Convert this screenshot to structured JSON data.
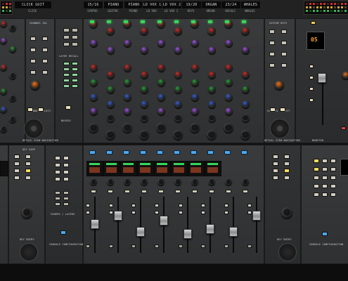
{
  "console": {
    "name": "Mixing Console Surface"
  },
  "scribble_strips": [
    {
      "top": "CLICK GUIT",
      "sub": "CLICK"
    },
    {
      "top": "15/16",
      "sub": "SYNTHS"
    },
    {
      "top": "PIANO",
      "sub": "GUITAR"
    },
    {
      "top": "PIANO",
      "sub": "PIANO"
    },
    {
      "top": "LD VOX 1",
      "sub": "LD VOX"
    },
    {
      "top": "LD VOX 2",
      "sub": "LD VOX 2"
    },
    {
      "top": "19/20",
      "sub": "KEYS"
    },
    {
      "top": "ORGAN",
      "sub": "ORGAN"
    },
    {
      "top": "23/24",
      "sub": "VOCALS"
    },
    {
      "top": "WHALES",
      "sub": "WHALES"
    }
  ],
  "captions": {
    "left_top": "CHANNEL SEL",
    "left_mid": "CHANNEL SELECT",
    "left_bottom": "DETAIL VIEW NAVIGATION",
    "comp_top": "COMP",
    "gate_top": "GATE",
    "layers": "ALL SOLO",
    "layer_recall": "LAYER RECALL",
    "busses": "BUSSES",
    "custom": "CUSTOM",
    "channel_strips": "CHANNEL STRIPS",
    "right_top": "CUSTOM KEYS",
    "right_mid": "CHANNEL SELECT",
    "right_bottom": "DETAIL VIEW NAVIGATION",
    "far_right": "MONITOR",
    "keys_left": "KEY SAFE",
    "faders_caption": "FADERS / LAYERS",
    "bottom_left": "CONSOLE CONFIGURATION",
    "bottom_right": "CONSOLE CONFIGURATION",
    "fader_labels": "FADER LABELS",
    "key_label": "KEY ENTRY",
    "key_label_right": "KEY ENTRY",
    "screen_value": "05"
  },
  "colors": {
    "knob_red": "#c8322c",
    "knob_green": "#2e9b3c",
    "knob_purple": "#9a56d6",
    "knob_blue": "#3a5fc8",
    "knob_dark": "#1b1b1c",
    "knob_orange": "#e8721d",
    "led_green": "#38d65a",
    "led_amber": "#f3b33d",
    "btn_blue": "#4aa8f0",
    "btn_cream": "#e9ddb9",
    "btn_green": "#7bd28a"
  },
  "fader_levels": [
    0.55,
    0.72,
    0.38,
    0.62,
    0.35,
    0.45,
    0.38,
    0.72,
    0.55,
    0.25
  ]
}
